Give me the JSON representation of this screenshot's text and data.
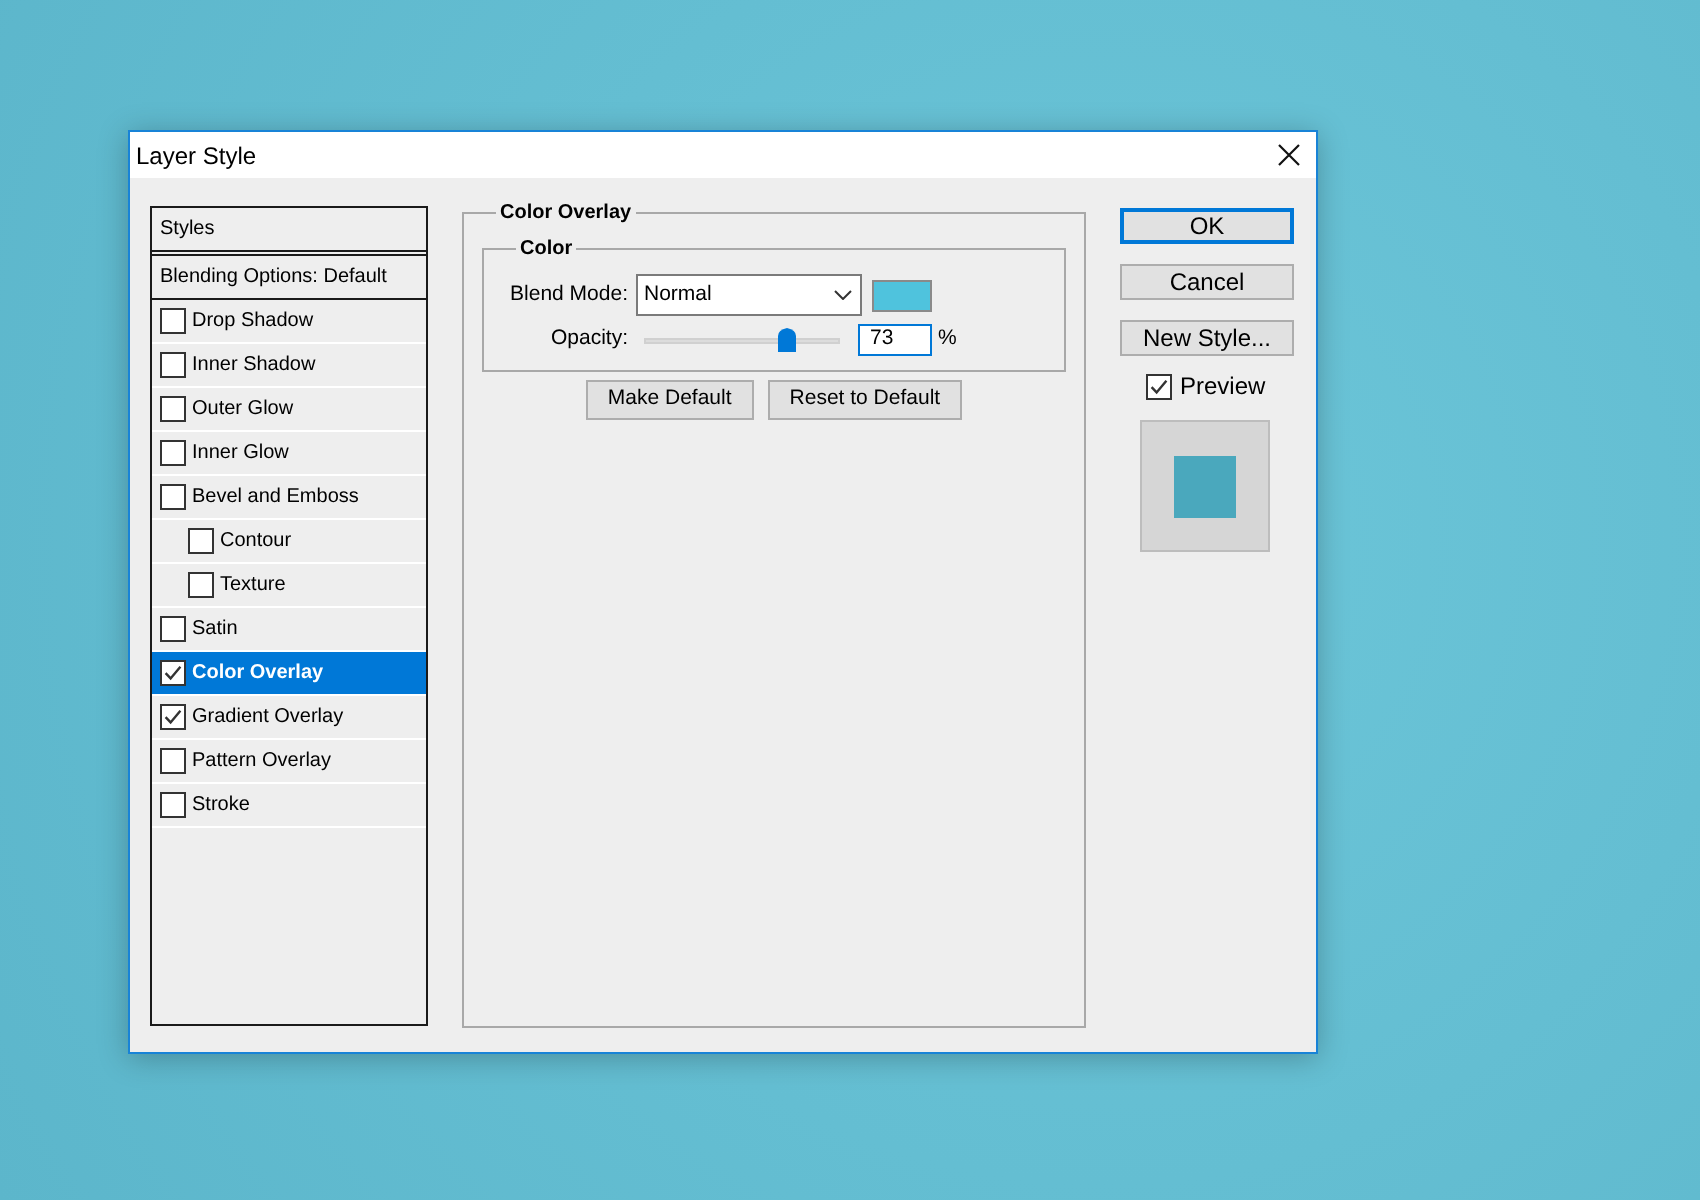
{
  "window": {
    "title": "Layer Style"
  },
  "styles_list": {
    "header": {
      "label": "Styles",
      "selected": false
    },
    "blending_options": {
      "label": "Blending Options: Default",
      "selected": false
    },
    "items": [
      {
        "label": "Drop Shadow",
        "checked": false,
        "selected": false
      },
      {
        "label": "Inner Shadow",
        "checked": false,
        "selected": false
      },
      {
        "label": "Outer Glow",
        "checked": false,
        "selected": false
      },
      {
        "label": "Inner Glow",
        "checked": false,
        "selected": false
      },
      {
        "label": "Bevel and Emboss",
        "checked": false,
        "selected": false,
        "children": [
          {
            "label": "Contour",
            "checked": false,
            "selected": false
          },
          {
            "label": "Texture",
            "checked": false,
            "selected": false
          }
        ]
      },
      {
        "label": "Satin",
        "checked": false,
        "selected": false
      },
      {
        "label": "Color Overlay",
        "checked": true,
        "selected": true
      },
      {
        "label": "Gradient Overlay",
        "checked": true,
        "selected": false
      },
      {
        "label": "Pattern Overlay",
        "checked": false,
        "selected": false
      },
      {
        "label": "Stroke",
        "checked": false,
        "selected": false
      }
    ]
  },
  "panel": {
    "title": "Color Overlay",
    "group": {
      "title": "Color",
      "blend_mode": {
        "label": "Blend Mode:",
        "value": "Normal",
        "color": "#4fc3dd"
      },
      "opacity": {
        "label": "Opacity:",
        "level": 0.73,
        "value": "73",
        "unit": "%"
      }
    },
    "buttons": [
      "Make Default",
      "Reset to Default"
    ]
  },
  "actions": {
    "buttons": [
      {
        "label": "OK",
        "default": true
      },
      {
        "label": "Cancel",
        "default": false
      },
      {
        "label": "New Style...",
        "default": false
      }
    ],
    "preview": {
      "label": "Preview",
      "checked": true
    }
  }
}
